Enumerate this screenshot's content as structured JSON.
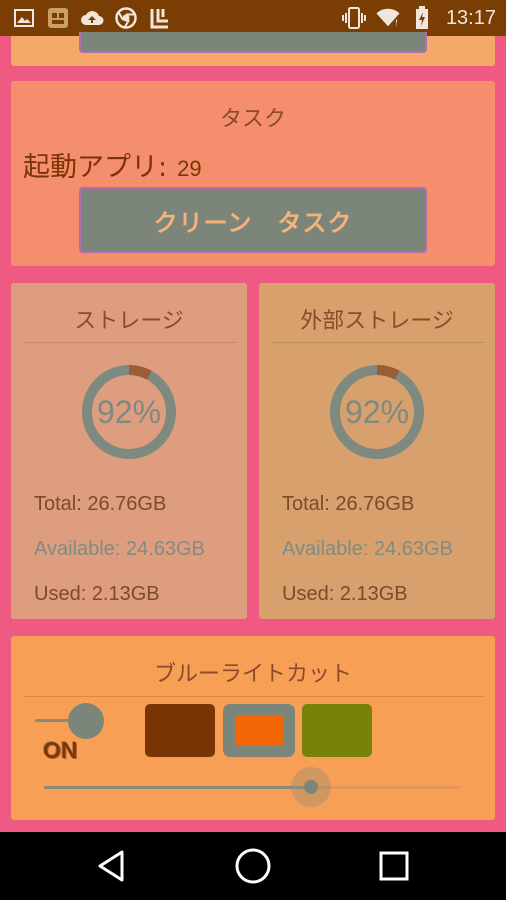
{
  "status_bar": {
    "time": "13:17",
    "left_icons": [
      "image-icon",
      "app-icon",
      "cloud-upload-icon",
      "chrome-icon",
      "app-icon"
    ],
    "right_icons": [
      "vibrate-icon",
      "wifi-icon",
      "battery-icon"
    ]
  },
  "task_card": {
    "title": "タスク",
    "running_apps_label": "起動アプリ",
    "colon": ":",
    "running_apps_count": "29",
    "clean_button_label": "クリーン　タスク"
  },
  "storage_internal": {
    "title": "ストレージ",
    "percent_label": "92%",
    "percent": 92,
    "total": "Total: 26.76GB",
    "available": "Available: 24.63GB",
    "used": "Used: 2.13GB"
  },
  "storage_external": {
    "title": "外部ストレージ",
    "percent_label": "92%",
    "percent": 92,
    "total": "Total: 26.76GB",
    "available": "Available: 24.63GB",
    "used": "Used: 2.13GB"
  },
  "blue_light": {
    "title": "ブルーライトカット",
    "toggle_state": "ON",
    "slider_value_fraction": 0.64,
    "swatches": [
      "#7a3406",
      "#f26605",
      "#798208"
    ]
  },
  "colors": {
    "background": "#ee5a82",
    "status_bar": "#7a3e05",
    "button": "#7b857a",
    "gauge_progress": "#9a5d35"
  }
}
